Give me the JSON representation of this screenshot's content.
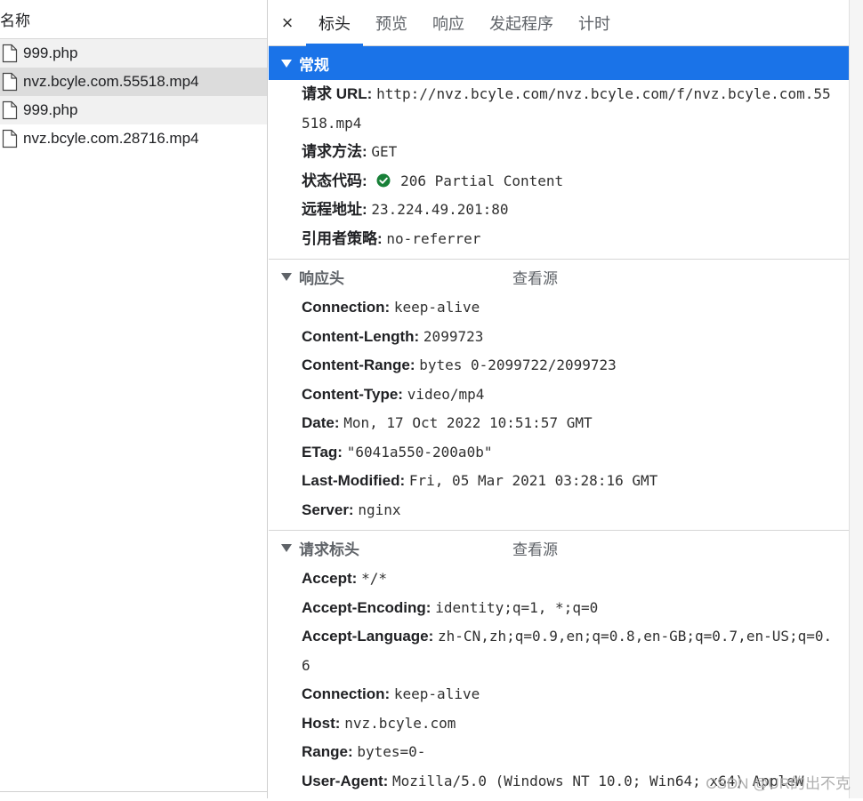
{
  "request_list": {
    "header": "名称",
    "items": [
      {
        "name": "999.php"
      },
      {
        "name": "nvz.bcyle.com.55518.mp4"
      },
      {
        "name": "999.php"
      },
      {
        "name": "nvz.bcyle.com.28716.mp4"
      }
    ]
  },
  "tabs": {
    "close": "×",
    "items": [
      "标头",
      "预览",
      "响应",
      "发起程序",
      "计时"
    ]
  },
  "general": {
    "title": "常规",
    "url_key": "请求 URL:",
    "url_val": "http://nvz.bcyle.com/nvz.bcyle.com/f/nvz.bcyle.com.55518.mp4",
    "method_key": "请求方法:",
    "method_val": "GET",
    "status_key": "状态代码:",
    "status_val": "206 Partial Content",
    "remote_key": "远程地址:",
    "remote_val": "23.224.49.201:80",
    "referrer_key": "引用者策略:",
    "referrer_val": "no-referrer"
  },
  "response_headers": {
    "title": "响应头",
    "view_source": "查看源",
    "rows": [
      {
        "k": "Connection:",
        "v": "keep-alive"
      },
      {
        "k": "Content-Length:",
        "v": "2099723"
      },
      {
        "k": "Content-Range:",
        "v": "bytes 0-2099722/2099723"
      },
      {
        "k": "Content-Type:",
        "v": "video/mp4"
      },
      {
        "k": "Date:",
        "v": "Mon, 17 Oct 2022 10:51:57 GMT"
      },
      {
        "k": "ETag:",
        "v": "\"6041a550-200a0b\""
      },
      {
        "k": "Last-Modified:",
        "v": "Fri, 05 Mar 2021 03:28:16 GMT"
      },
      {
        "k": "Server:",
        "v": "nginx"
      }
    ]
  },
  "request_headers": {
    "title": "请求标头",
    "view_source": "查看源",
    "rows": [
      {
        "k": "Accept:",
        "v": "*/*"
      },
      {
        "k": "Accept-Encoding:",
        "v": "identity;q=1, *;q=0"
      },
      {
        "k": "Accept-Language:",
        "v": "zh-CN,zh;q=0.9,en;q=0.8,en-GB;q=0.7,en-US;q=0.6"
      },
      {
        "k": "Connection:",
        "v": "keep-alive"
      },
      {
        "k": "Host:",
        "v": "nvz.bcyle.com"
      },
      {
        "k": "Range:",
        "v": "bytes=0-"
      },
      {
        "k": "User-Agent:",
        "v": "Mozilla/5.0 (Windows NT 10.0; Win64; x64) AppleW"
      }
    ]
  },
  "watermark": "CSDN @UR的出不克",
  "colors": {
    "accent": "#1a73e8",
    "status_ok": "#188038",
    "selected_row": "#dcdcdc"
  },
  "icons": {
    "file": "file-icon",
    "close": "close-icon",
    "collapse": "triangle-down-icon",
    "status": "check-circle-icon"
  }
}
